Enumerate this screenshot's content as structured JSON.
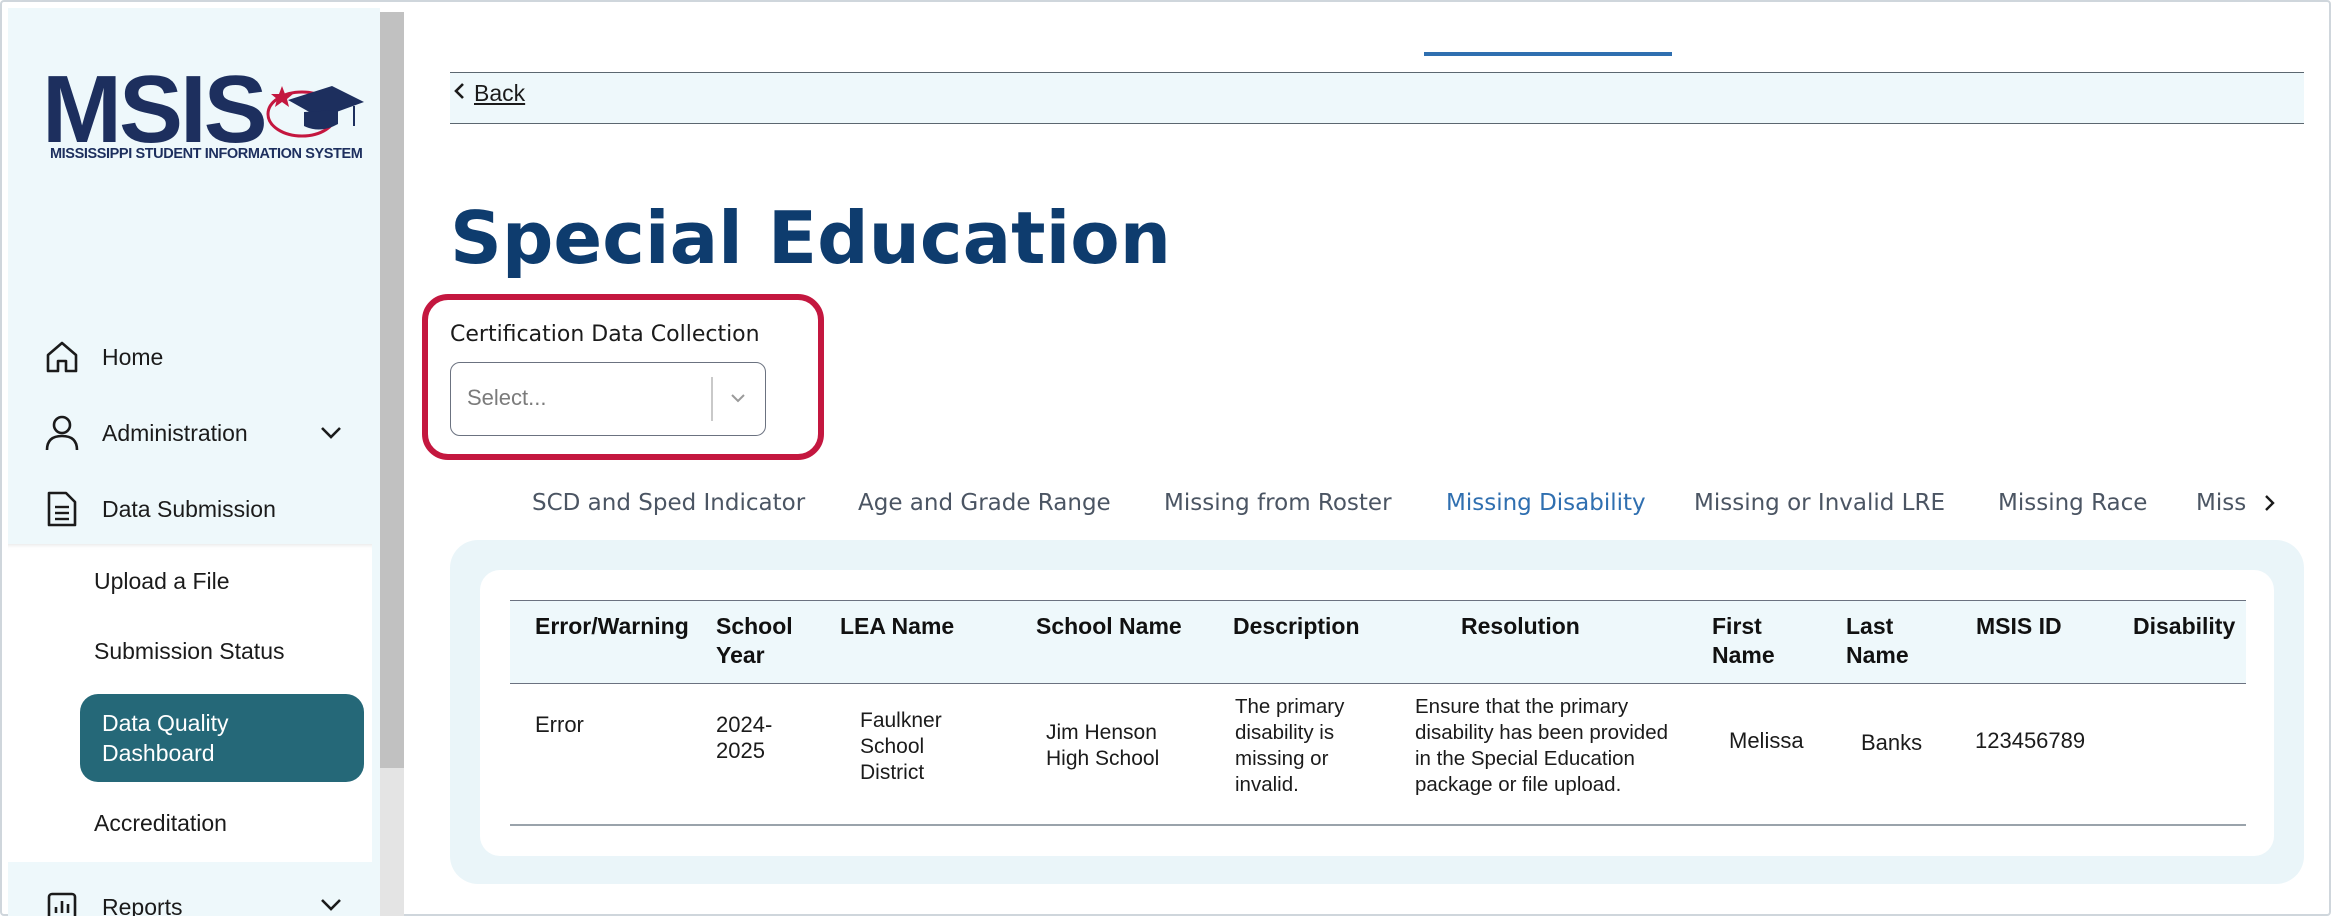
{
  "logo": {
    "main": "MSIS",
    "subtitle": "MISSISSIPPI STUDENT INFORMATION SYSTEM"
  },
  "sidebar": {
    "items": [
      {
        "label": "Home",
        "icon": "home-icon"
      },
      {
        "label": "Administration",
        "icon": "user-icon"
      },
      {
        "label": "Data Submission",
        "icon": "document-icon"
      },
      {
        "label": "Reports",
        "icon": "bar-chart-icon"
      }
    ],
    "sub_items": [
      {
        "label": "Upload a File"
      },
      {
        "label": "Submission Status"
      },
      {
        "label": "Data Quality Dashboard",
        "active": true
      },
      {
        "label": "Accreditation"
      }
    ]
  },
  "back": {
    "label": "Back"
  },
  "page": {
    "title": "Special Education"
  },
  "select": {
    "label": "Certification Data Collection",
    "placeholder": "Select..."
  },
  "tabs": [
    {
      "label": "SCD and Sped Indicator"
    },
    {
      "label": "Age and Grade Range"
    },
    {
      "label": "Missing from Roster"
    },
    {
      "label": "Missing Disability",
      "active": true
    },
    {
      "label": "Missing or Invalid LRE"
    },
    {
      "label": "Missing Race"
    },
    {
      "label": "Miss"
    }
  ],
  "table": {
    "headers": {
      "error": "Error/Warning",
      "year_1": "School",
      "year_2": "Year",
      "lea": "LEA Name",
      "school": "School Name",
      "description": "Description",
      "resolution": "Resolution",
      "first_1": "First",
      "first_2": "Name",
      "last_1": "Last",
      "last_2": "Name",
      "msis": "MSIS ID",
      "disability": "Disability"
    },
    "row": {
      "error": "Error",
      "year_1": "2024-",
      "year_2": "2025",
      "lea_1": "Faulkner",
      "lea_2": "School",
      "lea_3": "District",
      "school_1": "Jim Henson",
      "school_2": "High School",
      "desc_1": "The primary",
      "desc_2": "disability is",
      "desc_3": "missing or",
      "desc_4": "invalid.",
      "res_1": "Ensure that the primary",
      "res_2": "disability has been provided",
      "res_3": "in the Special Education",
      "res_4": "package or file upload.",
      "first": "Melissa",
      "last": "Banks",
      "msis": "123456789",
      "disability": ""
    }
  },
  "colors": {
    "accent": "#256878",
    "title": "#0e3c6e",
    "highlight": "#c4173f",
    "tab_active": "#2f6fb0"
  }
}
